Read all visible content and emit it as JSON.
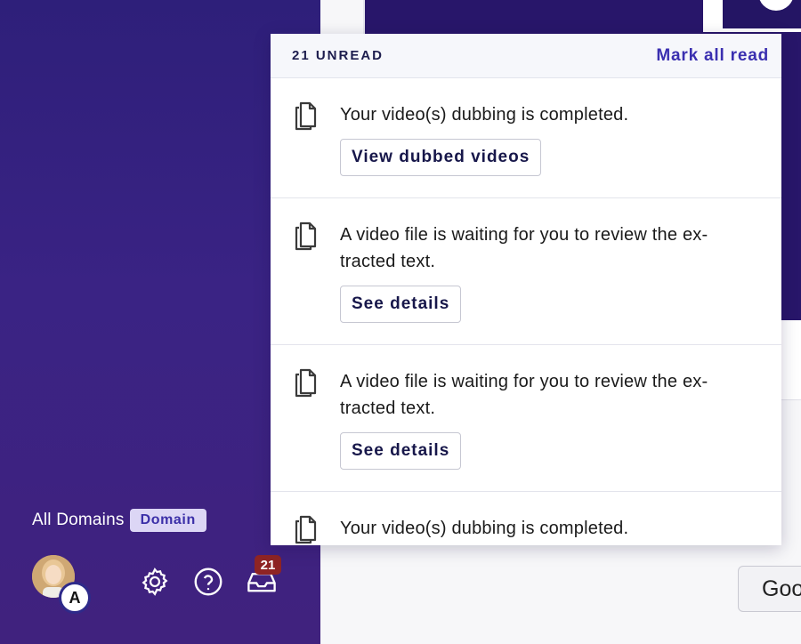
{
  "sidebar": {
    "domains_label": "All Domains",
    "domain_badge": "Domain",
    "avatar_initial": "A",
    "inbox_count": "21",
    "icons": [
      "settings-gear-icon",
      "help-question-icon",
      "inbox-tray-icon"
    ]
  },
  "notifications": {
    "unread_label": "21 UNREAD",
    "mark_all_label": "Mark all read",
    "items": [
      {
        "text": "Your video(s) dubbing is completed.",
        "button": "View dubbed videos",
        "icon": "document-copy-icon"
      },
      {
        "text": "A video file is waiting for you to review the ex-tracted text.",
        "button": "See details",
        "icon": "document-copy-icon"
      },
      {
        "text": "A video file is waiting for you to review the ex-tracted text.",
        "button": "See details",
        "icon": "document-copy-icon"
      },
      {
        "text": "Your video(s) dubbing is completed.",
        "icon": "document-copy-icon"
      }
    ]
  },
  "background": {
    "partial_button_label": "Goo"
  },
  "colors": {
    "sidebar_top": "#2e1f7a",
    "sidebar_bottom": "#40227e",
    "accent": "#3a2fb0",
    "badge_red": "#8e2424"
  }
}
